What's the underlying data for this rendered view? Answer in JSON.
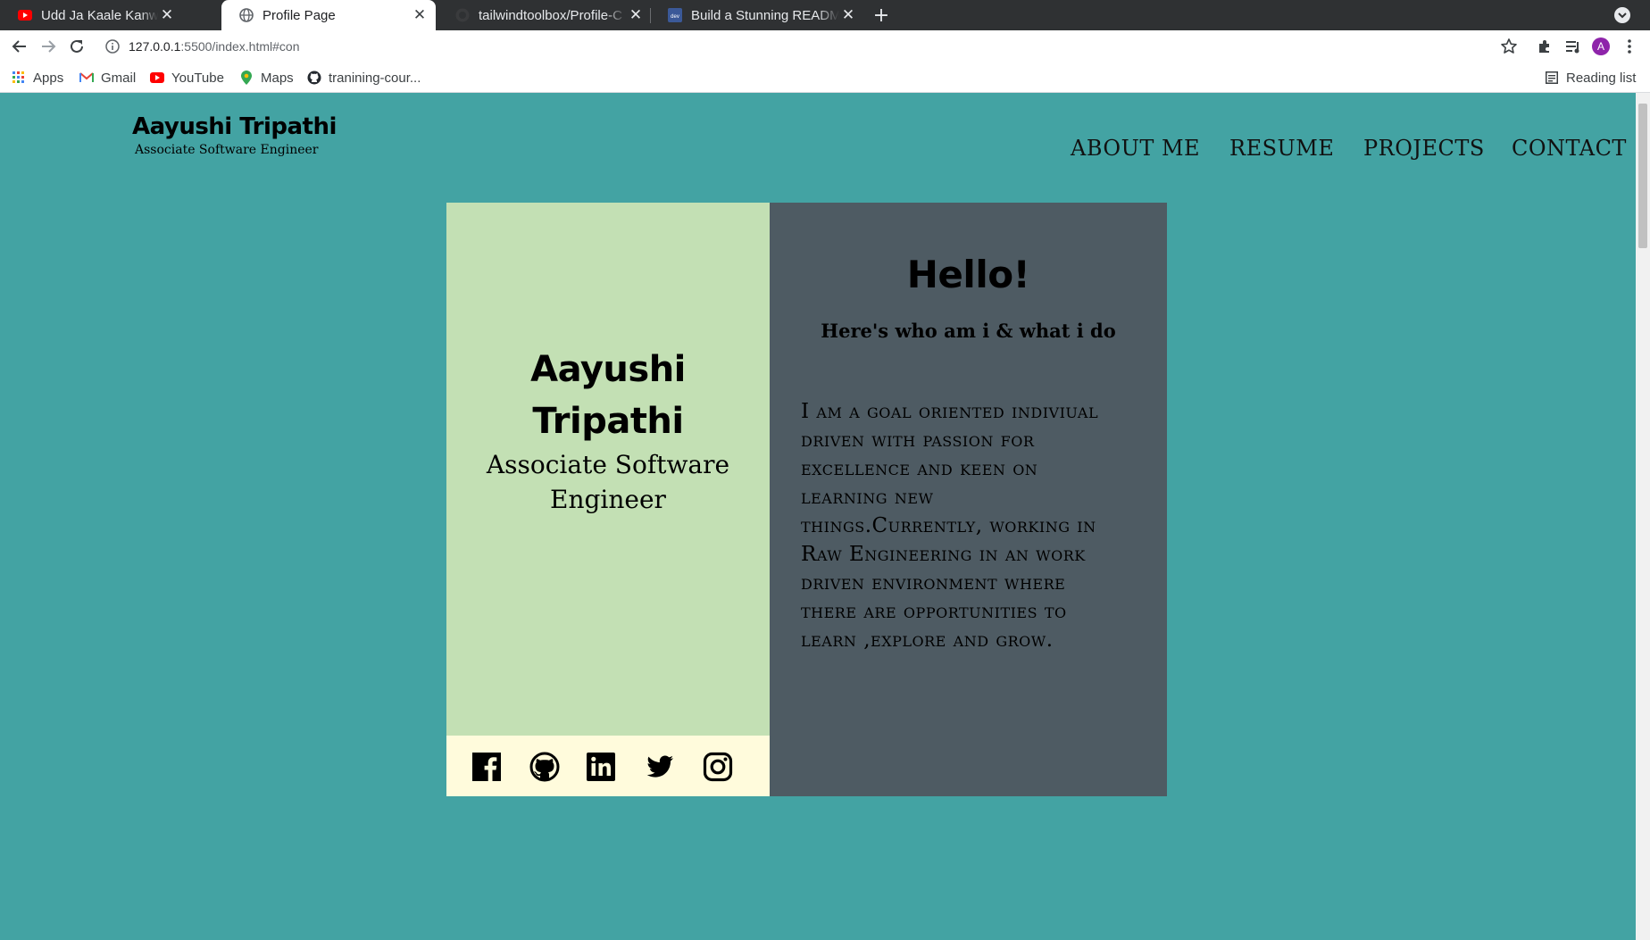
{
  "browser": {
    "tabs": [
      {
        "title": "Udd Ja Kaale Kanwan | Un",
        "icon": "youtube-icon",
        "active": false
      },
      {
        "title": "Profile Page",
        "icon": "globe-icon",
        "active": true
      },
      {
        "title": "tailwindtoolbox/Profile-C",
        "icon": "github-icon",
        "active": false
      },
      {
        "title": "Build a Stunning README",
        "icon": "dev-icon",
        "active": false
      }
    ],
    "new_tab": "+",
    "close": "✕",
    "url_host": "127.0.0.1",
    "url_rest": ":5500/index.html#con",
    "avatar_letter": "A",
    "bookmarks": [
      {
        "label": "Apps",
        "icon": "apps-grid-icon"
      },
      {
        "label": "Gmail",
        "icon": "gmail-icon"
      },
      {
        "label": "YouTube",
        "icon": "youtube-icon"
      },
      {
        "label": "Maps",
        "icon": "maps-icon"
      },
      {
        "label": "tranining-cour...",
        "icon": "github-icon"
      }
    ],
    "reading_list": "Reading list"
  },
  "site": {
    "brand_name": "Aayushi Tripathi",
    "brand_role": "Associate Software Engineer",
    "nav": [
      "ABOUT ME",
      "RESUME",
      "PROJECTS",
      "CONTACT"
    ]
  },
  "profile": {
    "name_line1": "Aayushi",
    "name_line2": "Tripathi",
    "role_line1": "Associate Software",
    "role_line2": "Engineer",
    "social": [
      "facebook-icon",
      "github-icon",
      "linkedin-icon",
      "twitter-icon",
      "instagram-icon"
    ]
  },
  "about": {
    "greeting": "Hello!",
    "subtitle": "Here's who am i & what i do",
    "bio_lines": [
      "I am a goal oriented indiviual",
      "driven with passion for",
      "excellence and keen on",
      "learning new",
      "things.Currently, working in",
      "Raw Engineering in an work",
      "driven environment where",
      "there are opportunities to",
      "learn ,explore and grow."
    ]
  },
  "colors": {
    "page_bg": "#43a3a3",
    "card_left": "#c3e0b4",
    "card_right": "#4e5b63",
    "social_bar": "#fffbdc"
  }
}
